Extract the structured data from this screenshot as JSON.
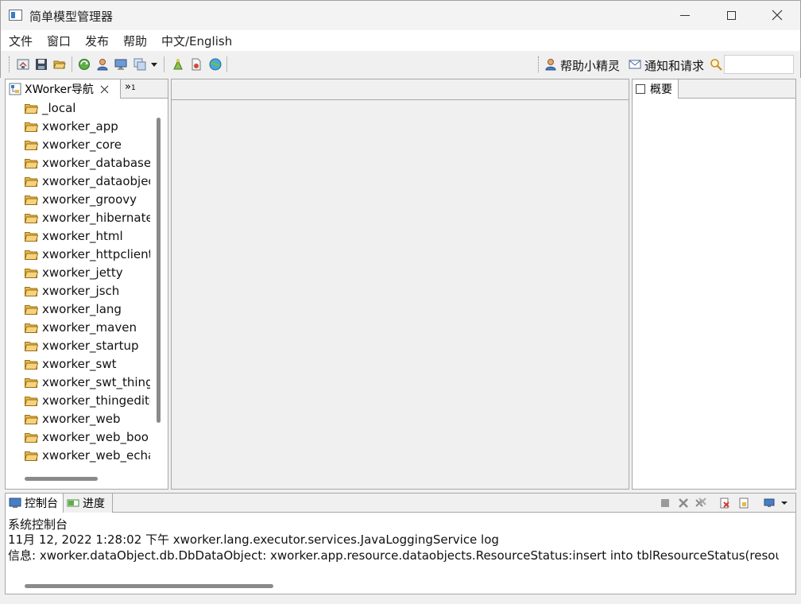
{
  "window": {
    "title": "简单模型管理器",
    "icon": "app-window-icon"
  },
  "menu": {
    "items": [
      {
        "label": "文件"
      },
      {
        "label": "窗口"
      },
      {
        "label": "发布"
      },
      {
        "label": "帮助"
      },
      {
        "label": "中文/English"
      }
    ]
  },
  "toolbar": {
    "icons": [
      "home-icon",
      "save-icon",
      "open-folder-icon",
      "refresh-icon",
      "user-icon",
      "monitor-icon",
      "copy-icon",
      "dropdown-icon",
      "thing-icon",
      "document-icon",
      "globe-icon"
    ],
    "help_label": "帮助小精灵",
    "notify_label": "通知和请求",
    "search_value": ""
  },
  "nav": {
    "tab_label": "XWorker导航",
    "overflow_label": "»",
    "overflow_count": "1",
    "items": [
      "_local",
      "xworker_app",
      "xworker_core",
      "xworker_database",
      "xworker_dataobjec",
      "xworker_groovy",
      "xworker_hibernate",
      "xworker_html",
      "xworker_httpclient",
      "xworker_jetty",
      "xworker_jsch",
      "xworker_lang",
      "xworker_maven",
      "xworker_startup",
      "xworker_swt",
      "xworker_swt_thing",
      "xworker_thingedito",
      "xworker_web",
      "xworker_web_boo",
      "xworker_web_echa"
    ]
  },
  "overview": {
    "tab_label": "概要"
  },
  "console": {
    "tabs": [
      {
        "label": "控制台"
      },
      {
        "label": "进度"
      }
    ],
    "heading": "系统控制台",
    "lines": [
      "11月 12, 2022 1:28:02 下午 xworker.lang.executor.services.JavaLoggingService log",
      "信息: xworker.dataObject.db.DbDataObject: xworker.app.resource.dataobjects.ResourceStatus:insert into tblResourceStatus(resource"
    ]
  },
  "colors": {
    "accent": "#3a7ac8",
    "folder": "#e8b84a",
    "border": "#a8a8a8"
  }
}
